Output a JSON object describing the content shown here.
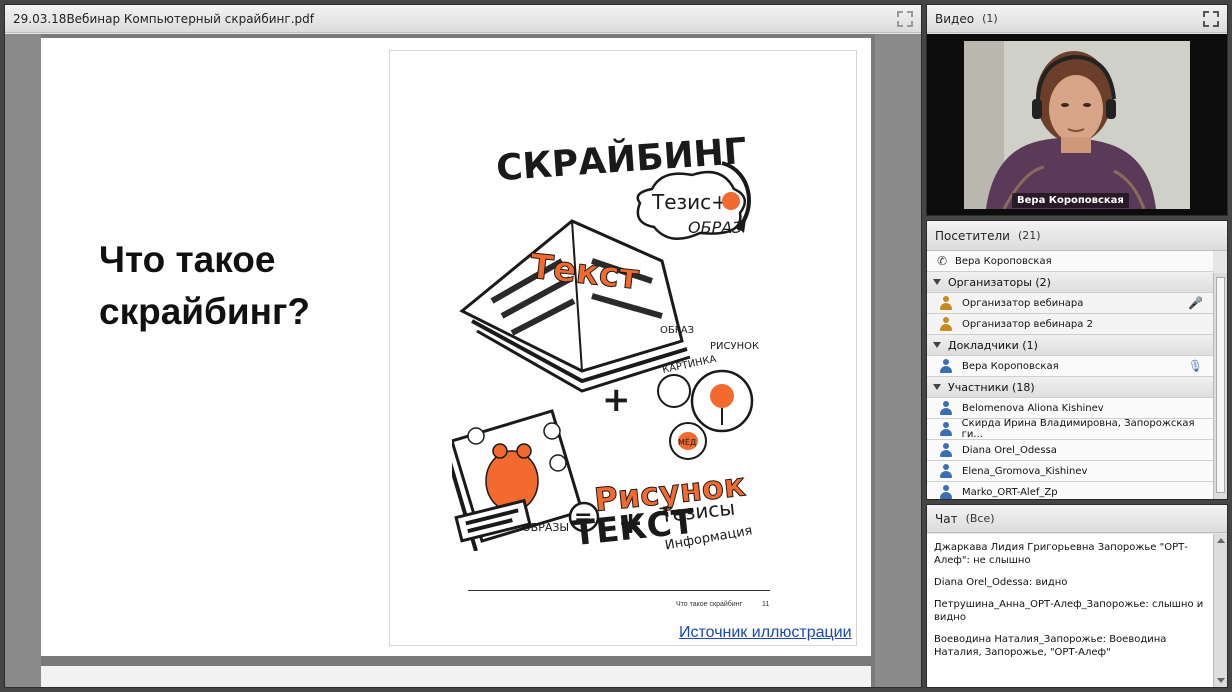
{
  "share_pod": {
    "title": "29.03.18Вебинар Компьютерный скрайбинг.pdf"
  },
  "slide": {
    "heading": "Что такое скрайбинг?",
    "page_footer": "Что такое скрайбинг",
    "page_number": "11",
    "source_link": "Источник иллюстрации",
    "illustration": {
      "word_scribing": "СКРАЙБИНГ",
      "word_thesis_plus": "Тезис+",
      "word_image": "ОБРАЗ",
      "word_text": "Текст",
      "word_obraz": "ОБРАЗ",
      "word_risunok_small": "РИСУНОК",
      "word_kartinka": "КАРТИНКА",
      "word_med": "МЁД",
      "word_risunok": "Рисунок",
      "word_obrazy": "ОБРАЗЫ",
      "word_tezisy": "Тезисы",
      "word_info": "Информация",
      "word_text_big": "ТЕКСТ"
    }
  },
  "video_pod": {
    "title": "Видео",
    "count": "(1)",
    "speaker_name": "Вера Короповская"
  },
  "attendees_pod": {
    "title": "Посетители",
    "count": "(21)",
    "phone_user": "Вера Короповская",
    "groups": {
      "hosts": "Организаторы (2)",
      "presenters": "Докладчики (1)",
      "participants": "Участники (18)"
    },
    "hosts": [
      "Организатор вебинара",
      "Организатор вебинара 2"
    ],
    "presenters": [
      "Вера Короповская"
    ],
    "participants": [
      "Belomenova Aliona Kishinev",
      "Скирда Ирина Владимировна, Запорожская ги...",
      "Diana Orel_Odessa",
      "Elena_Gromova_Kishinev",
      "Marko_ORT-Alef_Zp"
    ]
  },
  "chat_pod": {
    "title": "Чат",
    "scope": "(Все)",
    "messages": [
      {
        "sender": "Джаркава Лидия Григорьевна  Запорожье \"ОРТ-Алеф\"",
        "text": "не слышно"
      },
      {
        "sender": "Diana Orel_Odessa",
        "text": "видно"
      },
      {
        "sender": "Петрушина_Анна_ОРТ-Алеф_Запорожье",
        "text": "слышно и видно"
      },
      {
        "sender": "Воеводина Наталия_Запорожье",
        "text": "Воеводина Наталия, Запорожье, \"ОРТ-Алеф\""
      }
    ]
  },
  "colors": {
    "accent_orange": "#f26a2e",
    "link_blue": "#1a47b8",
    "mic_red": "#c0281a"
  }
}
